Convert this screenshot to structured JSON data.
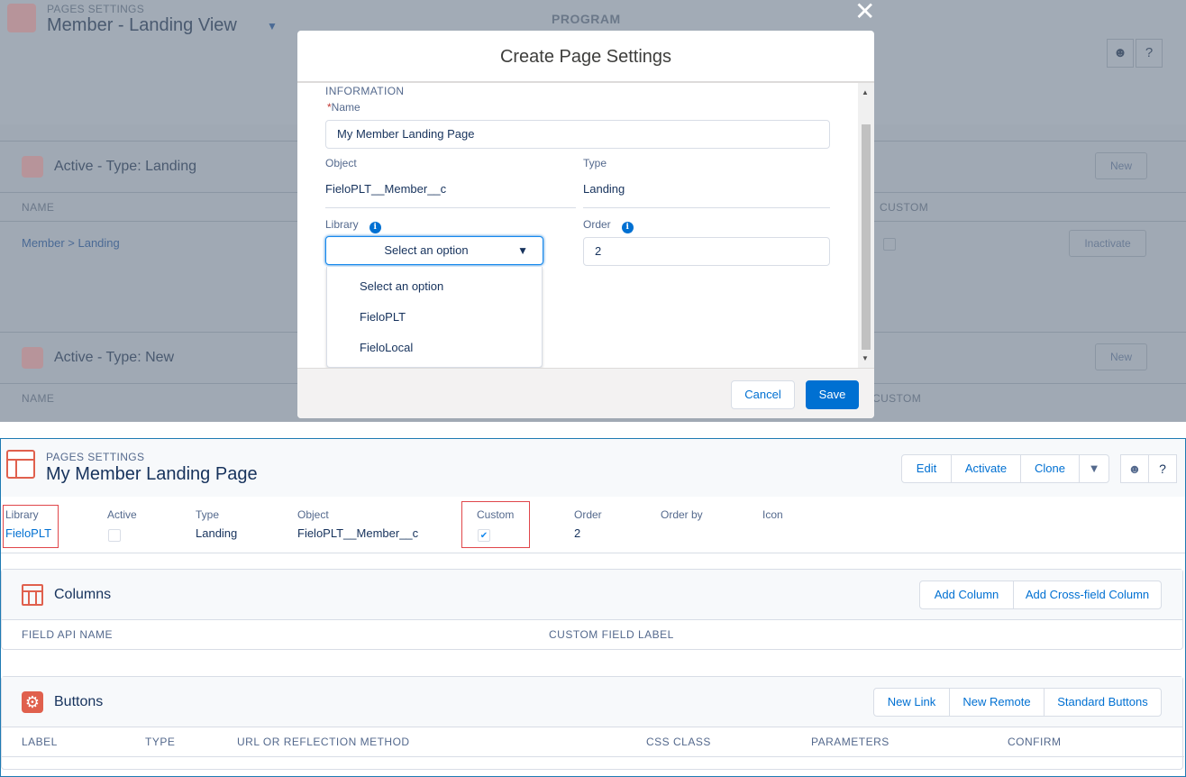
{
  "background": {
    "eyebrow": "PAGES SETTINGS",
    "title": "Member - Landing View",
    "program_label": "PROGRAM",
    "help_icon": "?",
    "card1": {
      "title": "Active - Type: Landing",
      "new_label": "New",
      "col_name": "NAME",
      "col_custom": "CUSTOM",
      "row_link": "Member > Landing",
      "inactivate_label": "Inactivate"
    },
    "card2": {
      "title": "Active - Type: New",
      "new_label": "New",
      "col_name": "NAME",
      "col_custom": "CUSTOM"
    }
  },
  "modal": {
    "title": "Create Page Settings",
    "section": "INFORMATION",
    "name_label": "Name",
    "required_mark": "*",
    "name_value": "My Member Landing Page",
    "object_label": "Object",
    "object_value": "FieloPLT__Member__c",
    "type_label": "Type",
    "type_value": "Landing",
    "library_label": "Library",
    "order_label": "Order",
    "order_value": "2",
    "info_glyph": "i",
    "select_value": "Select an option",
    "options": [
      "Select an option",
      "FieloPLT",
      "FieloLocal"
    ],
    "cancel_label": "Cancel",
    "save_label": "Save"
  },
  "record": {
    "eyebrow": "PAGES SETTINGS",
    "title": "My Member Landing Page",
    "actions": [
      "Edit",
      "Activate",
      "Clone"
    ],
    "help_icon": "?",
    "fields": {
      "library_label": "Library",
      "library_value": "FieloPLT",
      "active_label": "Active",
      "type_label": "Type",
      "type_value": "Landing",
      "object_label": "Object",
      "object_value": "FieloPLT__Member__c",
      "custom_label": "Custom",
      "order_label": "Order",
      "order_value": "2",
      "order_by_label": "Order by",
      "icon_label": "Icon"
    },
    "columns_card": {
      "title": "Columns",
      "add_column": "Add Column",
      "add_cross": "Add Cross-field Column",
      "headers": [
        "FIELD API NAME",
        "CUSTOM FIELD LABEL"
      ]
    },
    "buttons_card": {
      "title": "Buttons",
      "new_link": "New Link",
      "new_remote": "New Remote",
      "standard_buttons": "Standard Buttons",
      "headers": [
        "LABEL",
        "TYPE",
        "URL OR REFLECTION METHOD",
        "CSS CLASS",
        "PARAMETERS",
        "CONFIRM"
      ]
    }
  },
  "colors": {
    "brand": "#0070d2",
    "text": "#16325c",
    "label": "#54698d",
    "highlight": "#e0464a",
    "icon_accent": "#e0604d",
    "overlay": "#a0a9b4"
  }
}
